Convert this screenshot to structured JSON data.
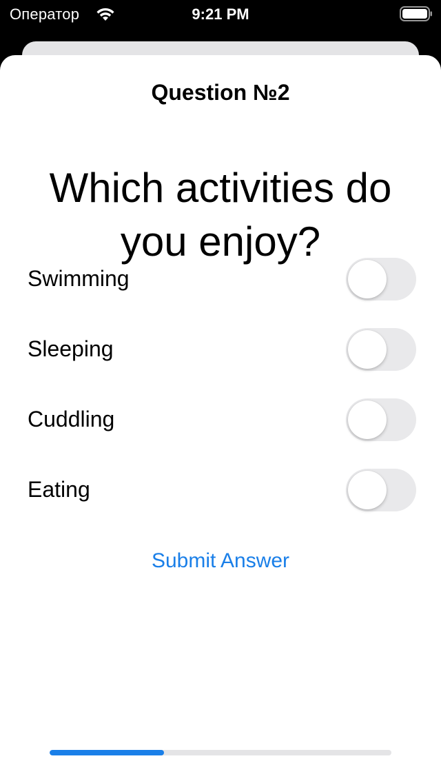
{
  "status_bar": {
    "carrier": "Оператор",
    "time": "9:21 PM",
    "wifi_icon": "wifi-icon",
    "battery_icon": "battery-icon"
  },
  "header": {
    "title": "Question №2"
  },
  "question": {
    "text": "Which activities do you enjoy?"
  },
  "options": [
    {
      "label": "Swimming",
      "on": false
    },
    {
      "label": "Sleeping",
      "on": false
    },
    {
      "label": "Cuddling",
      "on": false
    },
    {
      "label": "Eating",
      "on": false
    }
  ],
  "submit": {
    "label": "Submit Answer"
  },
  "progress": {
    "fraction": 0.335
  },
  "colors": {
    "accent": "#1a7fe8",
    "toggle_off": "#e9e9eb",
    "background": "#ffffff"
  }
}
